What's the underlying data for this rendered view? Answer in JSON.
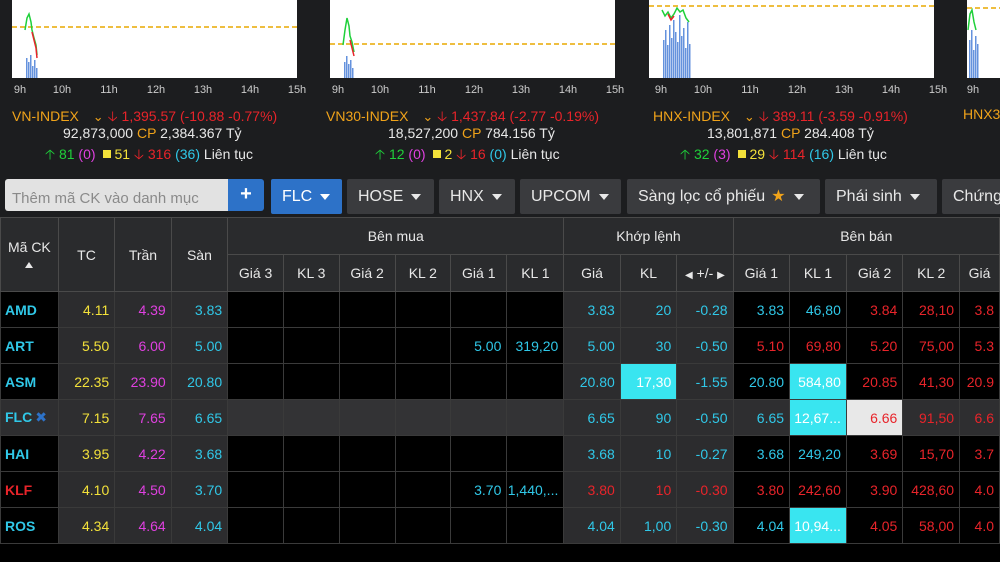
{
  "indices": [
    {
      "name": "VN-INDEX",
      "value": "1,395.57",
      "change": "(-10.88 -0.77%)",
      "volume": "92,873,000",
      "cp_label": "CP",
      "cp_value": "2,384.367 Tỷ",
      "up": "81",
      "ceil": "(0)",
      "ref": "51",
      "down": "316",
      "floor": "(36)",
      "status": "Liên tục",
      "times": [
        "9h",
        "10h",
        "11h",
        "12h",
        "13h",
        "14h",
        "15h"
      ]
    },
    {
      "name": "VN30-INDEX",
      "value": "1,437.84",
      "change": "(-2.77 -0.19%)",
      "volume": "18,527,200",
      "cp_label": "CP",
      "cp_value": "784.156 Tỷ",
      "up": "12",
      "ceil": "(0)",
      "ref": "2",
      "down": "16",
      "floor": "(0)",
      "status": "Liên tục",
      "times": [
        "9h",
        "10h",
        "11h",
        "12h",
        "13h",
        "14h",
        "15h"
      ]
    },
    {
      "name": "HNX-INDEX",
      "value": "389.11",
      "change": "(-3.59 -0.91%)",
      "volume": "13,801,871",
      "cp_label": "CP",
      "cp_value": "284.408 Tỷ",
      "up": "32",
      "ceil": "(3)",
      "ref": "29",
      "down": "114",
      "floor": "(16)",
      "status": "Liên tục",
      "times": [
        "9h",
        "10h",
        "11h",
        "12h",
        "13h",
        "14h",
        "15h"
      ]
    },
    {
      "name": "HNX3",
      "times": [
        "9h"
      ]
    }
  ],
  "toolbar": {
    "search_placeholder": "Thêm mã CK vào danh mục",
    "add_label": "+",
    "buttons": [
      "FLC",
      "HOSE",
      "HNX",
      "UPCOM",
      "Sàng lọc cổ phiếu",
      "Phái sinh",
      "Chứng"
    ]
  },
  "table": {
    "headers": {
      "symbol": "Mã CK",
      "tc": "TC",
      "tran": "Trần",
      "san": "Sàn",
      "ben_mua": "Bên mua",
      "khop_lenh": "Khớp lệnh",
      "ben_ban": "Bên bán",
      "gia3": "Giá 3",
      "kl3": "KL 3",
      "gia2": "Giá 2",
      "kl2": "KL 2",
      "gia1": "Giá 1",
      "kl1": "KL 1",
      "gia": "Giá",
      "kl": "KL",
      "change": "+/-",
      "sgia1": "Giá 1",
      "skl1": "KL 1",
      "sgia2": "Giá 2",
      "skl2": "KL 2",
      "sgia3": "Giá"
    },
    "rows": [
      {
        "sym": "AMD",
        "tc": "4.11",
        "tran": "4.39",
        "san": "3.83",
        "g3": "",
        "k3": "",
        "g2": "",
        "k2": "",
        "g1": "",
        "k1": "",
        "gia": "3.83",
        "kl": "20",
        "chg": "-0.28",
        "sg1": "3.83",
        "sk1": "46,80",
        "sg2": "3.84",
        "sk2": "28,10",
        "sg3": "3.8"
      },
      {
        "sym": "ART",
        "tc": "5.50",
        "tran": "6.00",
        "san": "5.00",
        "g3": "",
        "k3": "",
        "g2": "",
        "k2": "",
        "g1": "5.00",
        "k1": "319,20",
        "gia": "5.00",
        "kl": "30",
        "chg": "-0.50",
        "sg1": "5.10",
        "sk1": "69,80",
        "sg2": "5.20",
        "sk2": "75,00",
        "sg3": "5.3"
      },
      {
        "sym": "ASM",
        "tc": "22.35",
        "tran": "23.90",
        "san": "20.80",
        "g3": "",
        "k3": "",
        "g2": "",
        "k2": "",
        "g1": "",
        "k1": "",
        "gia": "20.80",
        "kl": "17,30",
        "chg": "-1.55",
        "sg1": "20.80",
        "sk1": "584,80",
        "sg2": "20.85",
        "sk2": "41,30",
        "sg3": "20.9"
      },
      {
        "sym": "FLC",
        "tc": "7.15",
        "tran": "7.65",
        "san": "6.65",
        "g3": "",
        "k3": "",
        "g2": "",
        "k2": "",
        "g1": "",
        "k1": "",
        "gia": "6.65",
        "kl": "90",
        "chg": "-0.50",
        "sg1": "6.65",
        "sk1": "12,67...",
        "sg2": "6.66",
        "sk2": "91,50",
        "sg3": "6.6"
      },
      {
        "sym": "HAI",
        "tc": "3.95",
        "tran": "4.22",
        "san": "3.68",
        "g3": "",
        "k3": "",
        "g2": "",
        "k2": "",
        "g1": "",
        "k1": "",
        "gia": "3.68",
        "kl": "10",
        "chg": "-0.27",
        "sg1": "3.68",
        "sk1": "249,20",
        "sg2": "3.69",
        "sk2": "15,70",
        "sg3": "3.7"
      },
      {
        "sym": "KLF",
        "tc": "4.10",
        "tran": "4.50",
        "san": "3.70",
        "g3": "",
        "k3": "",
        "g2": "",
        "k2": "",
        "g1": "3.70",
        "k1": "1,440,...",
        "gia": "3.80",
        "kl": "10",
        "chg": "-0.30",
        "sg1": "3.80",
        "sk1": "242,60",
        "sg2": "3.90",
        "sk2": "428,60",
        "sg3": "4.0"
      },
      {
        "sym": "ROS",
        "tc": "4.34",
        "tran": "4.64",
        "san": "4.04",
        "g3": "",
        "k3": "",
        "g2": "",
        "k2": "",
        "g1": "",
        "k1": "",
        "gia": "4.04",
        "kl": "1,00",
        "chg": "-0.30",
        "sg1": "4.04",
        "sk1": "10,94...",
        "sg2": "4.05",
        "sk2": "58,00",
        "sg3": "4.0"
      }
    ]
  },
  "colors": {
    "up": "#1fd03a",
    "down": "#e8242a",
    "ref": "#f3e13a",
    "ceil": "#e040e0",
    "floor": "#30c8e8",
    "accent": "#2d72c8",
    "highlight": "#39e5f0"
  }
}
